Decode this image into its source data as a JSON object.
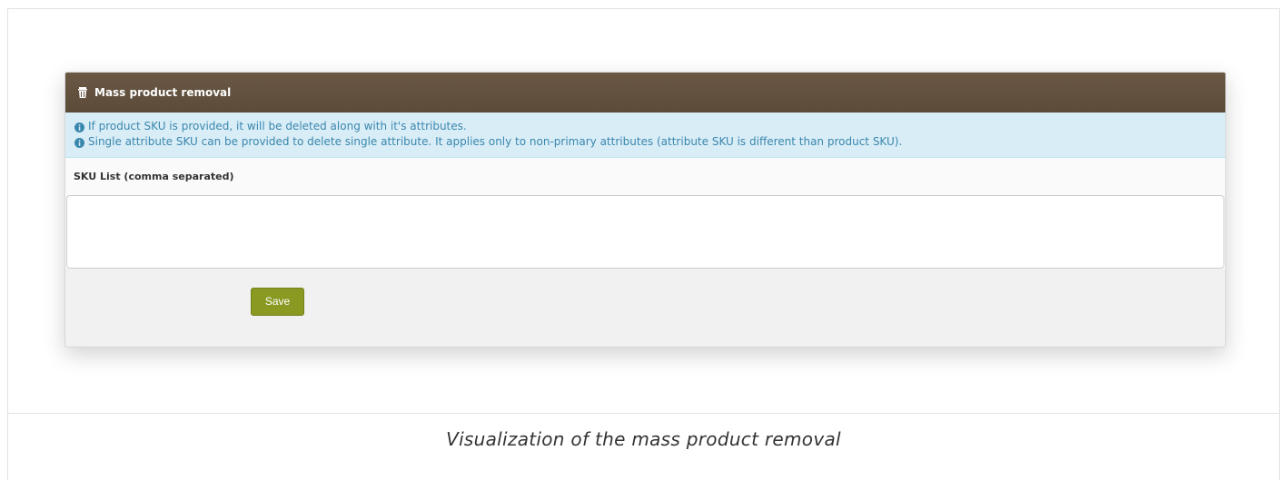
{
  "panel": {
    "title": "Mass product removal",
    "header_icon": "trash-icon",
    "info": {
      "icon": "info-circle-icon",
      "color": "#3a87ad",
      "background": "#d9edf7",
      "lines": [
        "If product SKU is provided, it will be deleted along with it's attributes.",
        "Single attribute SKU can be provided to delete single attribute. It applies only to non-primary attributes (attribute SKU is different than product SKU)."
      ]
    },
    "field": {
      "label": "SKU List (comma separated)",
      "value": "",
      "placeholder": ""
    },
    "save_label": "Save"
  },
  "colors": {
    "header_bg": "#5f4e3b",
    "save_button_bg": "#8a9922"
  },
  "caption": "Visualization of the mass product removal"
}
